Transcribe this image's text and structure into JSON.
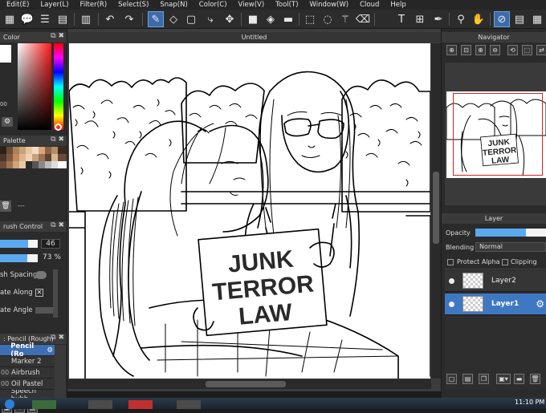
{
  "menu": [
    "Edit(E)",
    "Layer(L)",
    "Filter(R)",
    "Select(S)",
    "Snap(N)",
    "Color(C)",
    "View(V)",
    "Tool(T)",
    "Window(W)",
    "Cloud",
    "Help"
  ],
  "toolbar_icons": [
    "grid-icon",
    "comment-icon",
    "list-icon",
    "undo-icon",
    "redo-icon",
    "brush-icon",
    "eraser-icon",
    "rect-select-icon",
    "lasso-icon",
    "move-icon",
    "fill-rect-icon",
    "bucket-icon",
    "gradient-icon",
    "select-rect-icon",
    "select-lasso-icon",
    "magic-wand-icon",
    "select-eraser-icon",
    "text-icon",
    "layer-move-icon",
    "pen-icon",
    "eyedropper-icon",
    "hand-icon",
    "snap-off-icon",
    "snap-parallel-icon",
    "snap-grid-icon"
  ],
  "panels": {
    "color": {
      "title": "Color",
      "hex_value": "00"
    },
    "palette": {
      "title": "Palette",
      "placeholder": "---"
    },
    "brush_control": {
      "title": "rush Control",
      "size_value": "46",
      "opacity_value": "73",
      "opacity_unit": "%",
      "size_fill": 0.75,
      "opacity_fill": 0.73,
      "spacing_label": "sh Spacing",
      "rotate_along_label": "ate Along",
      "rotate_angle_label": "ate Angle"
    },
    "brush_list": {
      "title": ": Pencil (Rough)",
      "items": [
        {
          "num": "",
          "name": "Pencil (Ro"
        },
        {
          "num": "",
          "name": "Marker 2"
        },
        {
          "num": "00",
          "name": "Airbrush"
        },
        {
          "num": "00",
          "name": "Oil Pastel"
        },
        {
          "num": "",
          "name": "Speech bubb"
        }
      ]
    }
  },
  "canvas": {
    "title": "Untitled",
    "sign_line1": "JUNK",
    "sign_line2": "TERROR",
    "sign_line3": "LAW"
  },
  "navigator": {
    "title": "Navigator",
    "thumb_line1": "JUNK",
    "thumb_line2": "TERROR",
    "thumb_line3": "LAW"
  },
  "layer_panel": {
    "title": "Layer",
    "opacity_label": "Opacity",
    "opacity_fill": 0.72,
    "blending_label": "Blending",
    "blending_value": "Normal",
    "protect_alpha": "Protect Alpha",
    "clipping": "Clipping",
    "layers": [
      {
        "name": "Layer2",
        "selected": false
      },
      {
        "name": "Layer1",
        "selected": true
      }
    ]
  },
  "taskbar": {
    "time": "11:10 PM"
  },
  "colors": {
    "accent": "#3e78c2",
    "selected_brush": "#3e6fb3",
    "bar": "#5aa9f0"
  }
}
